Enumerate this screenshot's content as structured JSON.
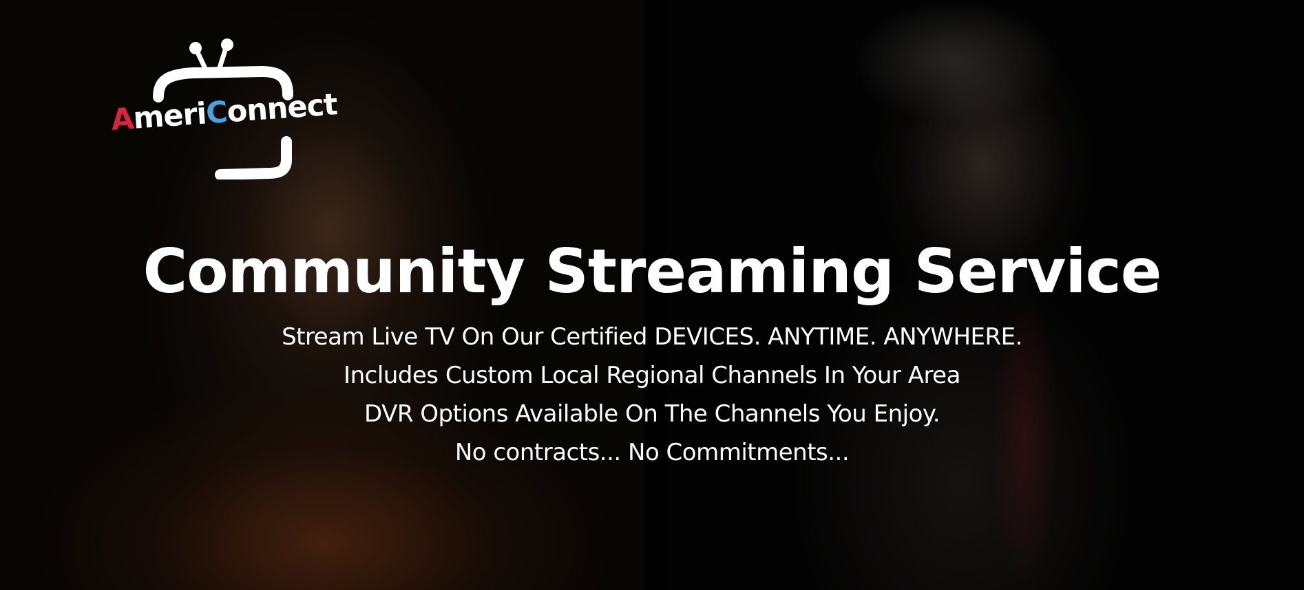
{
  "brand": {
    "logo_prefix": "A",
    "logo_mid": "meri",
    "logo_c": "C",
    "logo_suffix": "onnect",
    "colors": {
      "red": "#d8243c",
      "blue": "#4aa3df",
      "white": "#ffffff"
    },
    "icon": "tv-antenna-icon"
  },
  "hero": {
    "headline": "Community Streaming Service",
    "features": [
      "Stream Live TV On Our Certified DEVICES. ANYTIME. ANYWHERE.",
      "Includes Custom Local Regional Channels In Your Area",
      "DVR Options Available On The Channels You Enjoy.",
      "No contracts... No Commitments..."
    ]
  }
}
